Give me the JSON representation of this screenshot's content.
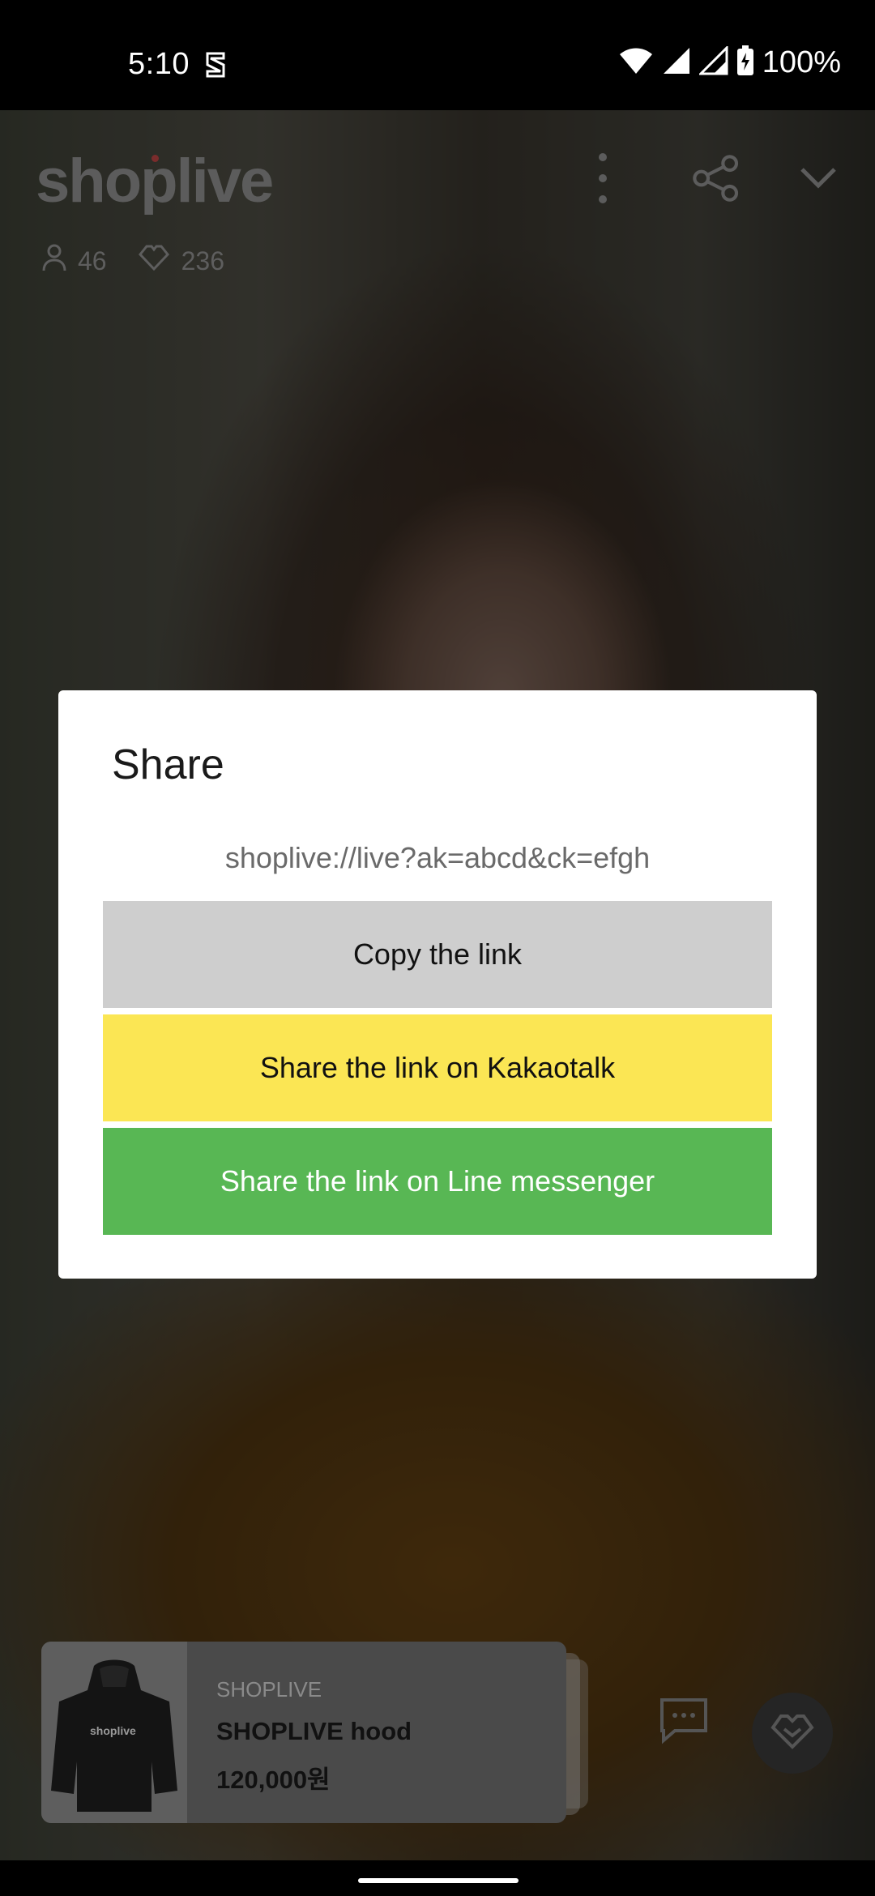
{
  "status_bar": {
    "time": "5:10",
    "battery": "100%"
  },
  "player": {
    "brand": "shoplive",
    "viewers": "46",
    "likes": "236"
  },
  "product": {
    "thumb_label": "shoplive",
    "brand": "SHOPLIVE",
    "name": "SHOPLIVE hood",
    "price": "120,000원"
  },
  "dialog": {
    "title": "Share",
    "url": "shoplive://live?ak=abcd&ck=efgh",
    "options": [
      {
        "label": "Copy the link",
        "color": "#cecece"
      },
      {
        "label": "Share the link on Kakaotalk",
        "color": "#fbe654"
      },
      {
        "label": "Share the link on Line messenger",
        "color": "#58b754"
      }
    ]
  }
}
